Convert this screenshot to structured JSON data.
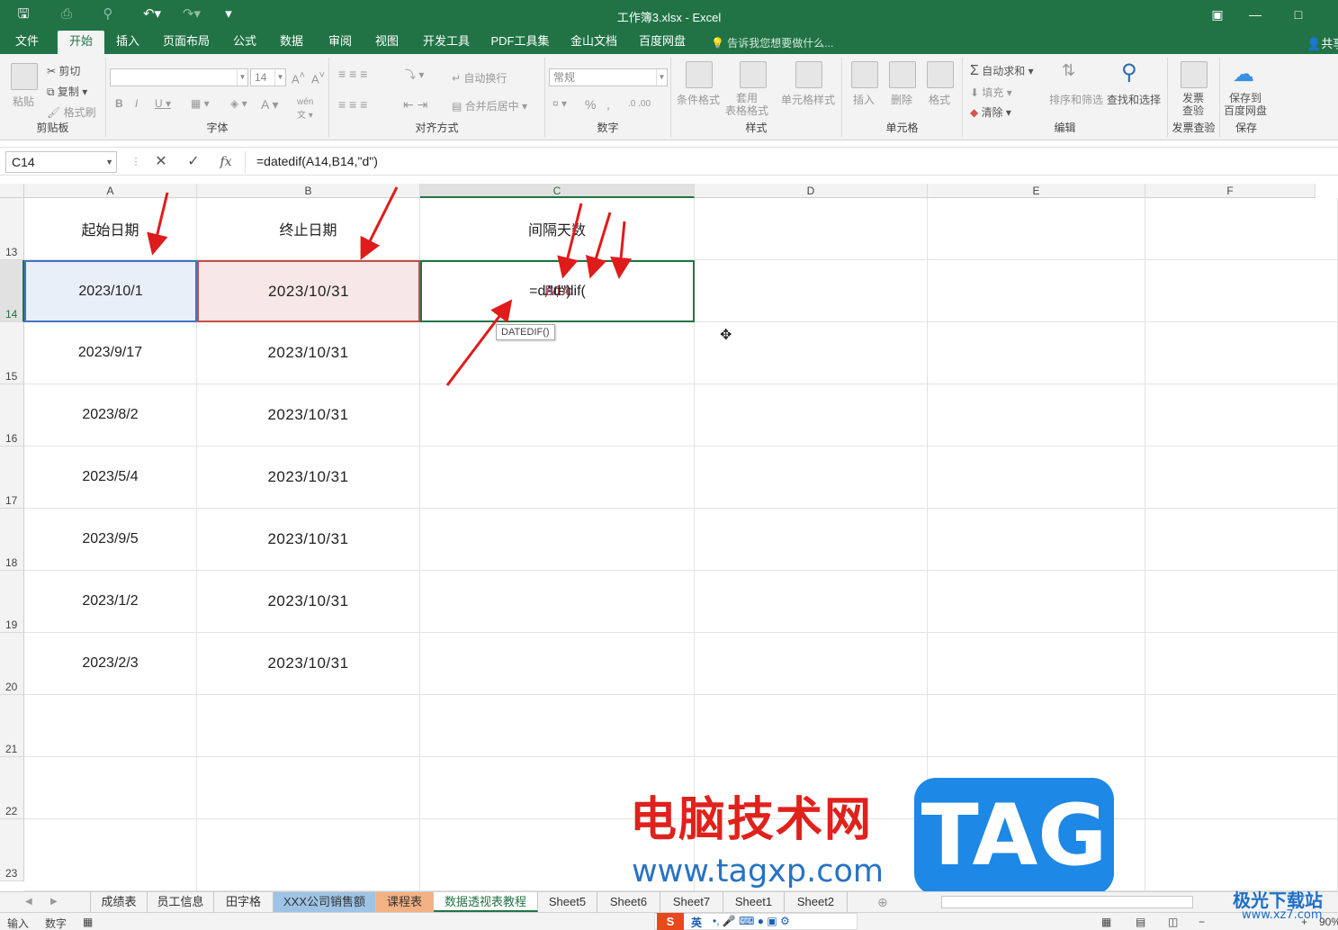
{
  "window": {
    "title": "工作簿3.xlsx - Excel",
    "accent_color": "#217346"
  },
  "menu": {
    "items": [
      "文件",
      "开始",
      "插入",
      "页面布局",
      "公式",
      "数据",
      "审阅",
      "视图",
      "开发工具",
      "PDF工具集",
      "金山文档",
      "百度网盘"
    ],
    "active": "开始",
    "tell_me": "告诉我您想要做什么...",
    "share": "共享"
  },
  "ribbon": {
    "clipboard": {
      "paste": "粘贴",
      "cut": "剪切",
      "copy": "复制",
      "format_painter": "格式刷",
      "label": "剪贴板"
    },
    "font": {
      "size": "14",
      "label": "字体"
    },
    "alignment": {
      "wrap": "自动换行",
      "merge": "合并后居中",
      "label": "对齐方式"
    },
    "number": {
      "format": "常规",
      "label": "数字"
    },
    "styles": {
      "conditional": "条件格式",
      "table": "套用\n表格格式",
      "cell_styles": "单元格样式",
      "label": "样式"
    },
    "cells": {
      "insert": "插入",
      "delete": "删除",
      "format": "格式",
      "label": "单元格"
    },
    "editing": {
      "autosum": "自动求和",
      "fill": "填充",
      "clear": "清除",
      "sort": "排序和筛选",
      "find": "查找和选择",
      "label": "编辑"
    },
    "invoice": {
      "check": "发票\n查验",
      "label": "发票查验"
    },
    "save": {
      "baidu": "保存到\n百度网盘",
      "label": "保存"
    }
  },
  "formula_bar": {
    "name_box": "C14",
    "formula": "=datedif(A14,B14,\"d\")"
  },
  "grid": {
    "columns": [
      "A",
      "B",
      "C",
      "D",
      "E",
      "F"
    ],
    "selected_column": "C",
    "headers": {
      "a": "起始日期",
      "b": "终止日期",
      "c": "间隔天数"
    },
    "rows": [
      {
        "num": "13",
        "a": "起始日期",
        "b": "终止日期",
        "c": "间隔天数"
      },
      {
        "num": "14",
        "a": "2023/10/1",
        "b": "2023/10/31",
        "c": ""
      },
      {
        "num": "15",
        "a": "2023/9/17",
        "b": "2023/10/31",
        "c": ""
      },
      {
        "num": "16",
        "a": "2023/8/2",
        "b": "2023/10/31",
        "c": ""
      },
      {
        "num": "17",
        "a": "2023/5/4",
        "b": "2023/10/31",
        "c": ""
      },
      {
        "num": "18",
        "a": "2023/9/5",
        "b": "2023/10/31",
        "c": ""
      },
      {
        "num": "19",
        "a": "2023/1/2",
        "b": "2023/10/31",
        "c": ""
      },
      {
        "num": "20",
        "a": "2023/2/3",
        "b": "2023/10/31",
        "c": ""
      },
      {
        "num": "21",
        "a": "",
        "b": "",
        "c": ""
      },
      {
        "num": "22",
        "a": "",
        "b": "",
        "c": ""
      },
      {
        "num": "23",
        "a": "",
        "b": "",
        "c": ""
      }
    ],
    "editing_cell": {
      "prefix": "=datedif(",
      "ref_a": "A14",
      "sep1": ",",
      "ref_b": "B14",
      "suffix": ",\"d\")",
      "ref_a_color": "#4472c4",
      "ref_b_color": "#c0504d"
    },
    "tooltip": "DATEDIF()"
  },
  "sheets": {
    "tabs": [
      "成绩表",
      "员工信息",
      "田字格",
      "XXX公司销售额",
      "课程表",
      "数据透视表教程",
      "Sheet5",
      "Sheet6",
      "Sheet7",
      "Sheet1",
      "Sheet2"
    ],
    "active": "数据透视表教程"
  },
  "status": {
    "mode": "输入",
    "num": "数字",
    "zoom": "90%"
  },
  "watermark": {
    "site_name": "电脑技术网",
    "url": "www.tagxp.com",
    "tag": "TAG",
    "site2": "极光下载站",
    "url2": "www.xz7.com"
  },
  "ime": {
    "lang": "英"
  }
}
